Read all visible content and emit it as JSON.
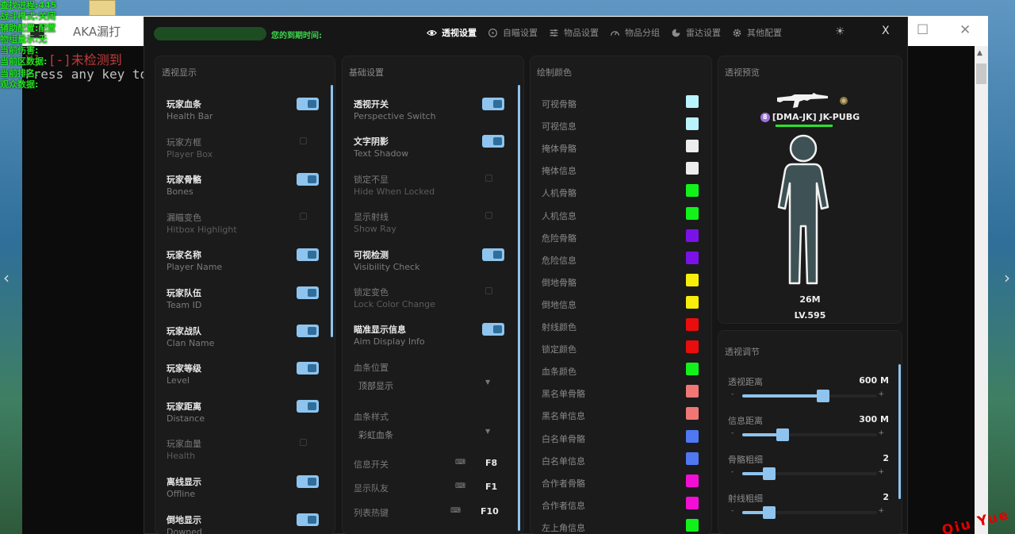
{
  "console": {
    "title": "AKA漏打",
    "line1": "X] [-]未检测到",
    "line2": "Press any key to"
  },
  "overlay": [
    "查找进程:445",
    "战斗模式:关闭",
    "辅助配置:配置",
    "物组量示:无",
    "当前伤害:",
    "当前区数据:",
    "当前排名:",
    "观众数据:"
  ],
  "watermark": "Qiu Yue",
  "header": {
    "expiry_label": "您的到期时间:",
    "tabs": [
      {
        "label": "透视设置",
        "icon": "eye-icon",
        "active": true
      },
      {
        "label": "自瞄设置",
        "icon": "crosshair-icon",
        "active": false
      },
      {
        "label": "物品设置",
        "icon": "sliders-icon",
        "active": false
      },
      {
        "label": "物品分组",
        "icon": "gauge-icon",
        "active": false
      },
      {
        "label": "雷达设置",
        "icon": "radar-icon",
        "active": false
      },
      {
        "label": "其他配置",
        "icon": "gear-icon",
        "active": false
      }
    ],
    "theme_icon": "☀",
    "close": "X"
  },
  "esp_display": {
    "title": "透视显示",
    "items": [
      {
        "zh": "玩家血条",
        "en": "Health Bar",
        "on": true
      },
      {
        "zh": "玩家方框",
        "en": "Player Box",
        "on": false
      },
      {
        "zh": "玩家骨骼",
        "en": "Bones",
        "on": true
      },
      {
        "zh": "漏瞄变色",
        "en": "Hitbox Highlight",
        "on": false
      },
      {
        "zh": "玩家名称",
        "en": "Player Name",
        "on": true
      },
      {
        "zh": "玩家队伍",
        "en": "Team ID",
        "on": true
      },
      {
        "zh": "玩家战队",
        "en": "Clan Name",
        "on": true
      },
      {
        "zh": "玩家等级",
        "en": "Level",
        "on": true
      },
      {
        "zh": "玩家距离",
        "en": "Distance",
        "on": true
      },
      {
        "zh": "玩家血量",
        "en": "Health",
        "on": false
      },
      {
        "zh": "离线显示",
        "en": "Offline",
        "on": true
      },
      {
        "zh": "倒地显示",
        "en": "Downed",
        "on": true
      }
    ]
  },
  "base": {
    "title": "基础设置",
    "items": [
      {
        "zh": "透视开关",
        "en": "Perspective Switch",
        "on": true
      },
      {
        "zh": "文字阴影",
        "en": "Text Shadow",
        "on": true
      },
      {
        "zh": "锁定不显",
        "en": "Hide When Locked",
        "on": false
      },
      {
        "zh": "显示射线",
        "en": "Show Ray",
        "on": false
      },
      {
        "zh": "可视检测",
        "en": "Visibility Check",
        "on": true
      },
      {
        "zh": "锁定变色",
        "en": "Lock Color Change",
        "on": false
      },
      {
        "zh": "瞄准显示信息",
        "en": "Aim Display Info",
        "on": true
      }
    ],
    "fields": [
      {
        "label": "血条位置",
        "value": "顶部显示"
      },
      {
        "label": "血条样式",
        "value": "彩虹血条"
      }
    ],
    "hotkeys": [
      {
        "label": "信息开关",
        "key": "F8"
      },
      {
        "label": "显示队友",
        "key": "F1"
      },
      {
        "label": "列表热键",
        "key": "F10"
      }
    ]
  },
  "colors": {
    "title": "绘制颜色",
    "items": [
      {
        "label": "可视骨骼",
        "color": "#b9f3fb"
      },
      {
        "label": "可视信息",
        "color": "#b9f3fb"
      },
      {
        "label": "掩体骨骼",
        "color": "#ededed"
      },
      {
        "label": "掩体信息",
        "color": "#ededed"
      },
      {
        "label": "人机骨骼",
        "color": "#12f21a"
      },
      {
        "label": "人机信息",
        "color": "#12f21a"
      },
      {
        "label": "危险骨骼",
        "color": "#7a12e8"
      },
      {
        "label": "危险信息",
        "color": "#7a12e8"
      },
      {
        "label": "倒地骨骼",
        "color": "#f7ee0c"
      },
      {
        "label": "倒地信息",
        "color": "#f7ee0c"
      },
      {
        "label": "射线颜色",
        "color": "#ea0d0d"
      },
      {
        "label": "锁定颜色",
        "color": "#ea0d0d"
      },
      {
        "label": "血条颜色",
        "color": "#12f21a"
      },
      {
        "label": "黑名单骨骼",
        "color": "#f17676"
      },
      {
        "label": "黑名单信息",
        "color": "#f17676"
      },
      {
        "label": "白名单骨骼",
        "color": "#4f78f2"
      },
      {
        "label": "白名单信息",
        "color": "#4f78f2"
      },
      {
        "label": "合作者骨骼",
        "color": "#f20ed5"
      },
      {
        "label": "合作者信息",
        "color": "#f20ed5"
      },
      {
        "label": "左上角信息",
        "color": "#12f21a"
      }
    ]
  },
  "preview": {
    "title": "透视预览",
    "badge": "8",
    "name": "[DMA-JK]  JK-PUBG",
    "distance": "26M",
    "level": "LV.595"
  },
  "adjust": {
    "title": "透视调节",
    "sliders": [
      {
        "label": "透视距离",
        "value": "600 M",
        "fraction": 0.6
      },
      {
        "label": "信息距离",
        "value": "300 M",
        "fraction": 0.3
      },
      {
        "label": "骨骼粗细",
        "value": "2",
        "fraction": 0.2
      },
      {
        "label": "射线粗细",
        "value": "2",
        "fraction": 0.2
      }
    ]
  }
}
